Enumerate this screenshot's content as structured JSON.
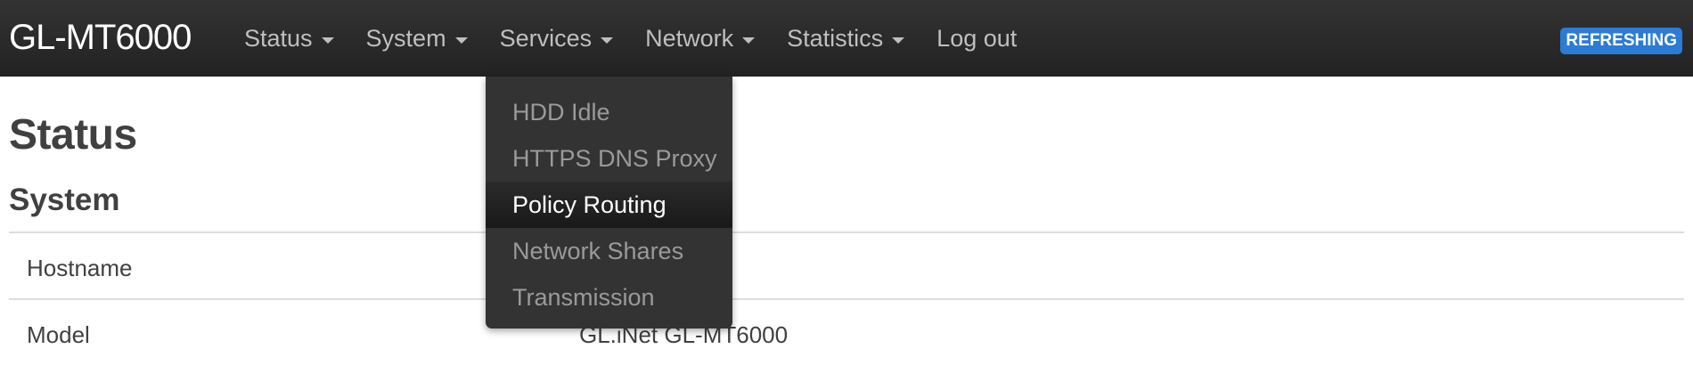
{
  "header": {
    "brand": "GL-MT6000",
    "badge": "REFRESHING"
  },
  "nav": {
    "items": [
      {
        "label": "Status",
        "dropdown": true
      },
      {
        "label": "System",
        "dropdown": true
      },
      {
        "label": "Services",
        "dropdown": true
      },
      {
        "label": "Network",
        "dropdown": true
      },
      {
        "label": "Statistics",
        "dropdown": true
      },
      {
        "label": "Log out",
        "dropdown": false
      }
    ]
  },
  "services_menu": {
    "items": [
      {
        "label": "HDD Idle"
      },
      {
        "label": "HTTPS DNS Proxy"
      },
      {
        "label": "Policy Routing"
      },
      {
        "label": "Network Shares"
      },
      {
        "label": "Transmission"
      }
    ],
    "active_index": 2
  },
  "main": {
    "page_title": "Status",
    "section_title": "System",
    "rows": [
      {
        "label": "Hostname",
        "value": ""
      },
      {
        "label": "Model",
        "value": "GL.iNet GL-MT6000"
      }
    ]
  },
  "colors": {
    "navbar": "#222222",
    "badge": "#2a7cd6",
    "dropdown": "#333333"
  }
}
